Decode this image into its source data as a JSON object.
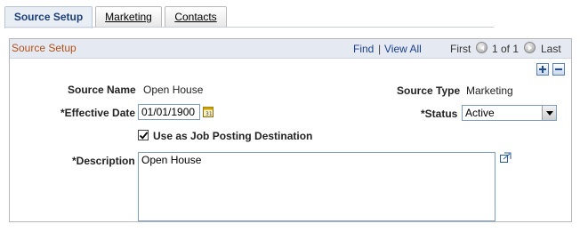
{
  "tabs": [
    {
      "label": "Source Setup"
    },
    {
      "label": "Marketing"
    },
    {
      "label": "Contacts"
    }
  ],
  "box": {
    "title": "Source Setup",
    "nav": {
      "find": "Find",
      "separator": "|",
      "view_all": "View All",
      "first": "First",
      "count": "1 of 1",
      "last": "Last"
    }
  },
  "form": {
    "source_name_label": "Source Name",
    "source_name_value": "Open House",
    "source_type_label": "Source Type",
    "source_type_value": "Marketing",
    "effective_date_label": "*Effective Date",
    "effective_date_value": "01/01/1900",
    "status_label": "*Status",
    "status_value": "Active",
    "job_posting_label": "Use as Job Posting Destination",
    "job_posting_checked": true,
    "description_label": "*Description",
    "description_value": "Open House"
  },
  "icons": {
    "add": "plus-icon",
    "delete": "minus-icon",
    "calendar": "calendar-icon",
    "expand": "expand-text-icon",
    "prev": "arrow-left-icon",
    "next": "arrow-right-icon"
  },
  "colors": {
    "link": "#1a3e8c",
    "box_title": "#b5501a",
    "header_bg": "#e5eaf2",
    "active_tab_text": "#1c3f7a"
  }
}
